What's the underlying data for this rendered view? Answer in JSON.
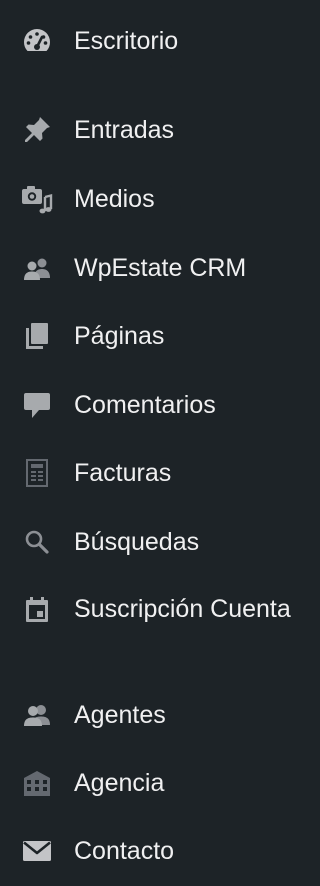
{
  "sidebar": {
    "items": [
      {
        "label": "Escritorio",
        "icon": "dashboard-icon"
      },
      {
        "label": "Entradas",
        "icon": "pin-icon"
      },
      {
        "label": "Medios",
        "icon": "media-icon"
      },
      {
        "label": "WpEstate CRM",
        "icon": "users-icon"
      },
      {
        "label": "Páginas",
        "icon": "pages-icon"
      },
      {
        "label": "Comentarios",
        "icon": "comment-icon"
      },
      {
        "label": "Facturas",
        "icon": "invoice-icon"
      },
      {
        "label": "Búsquedas",
        "icon": "search-icon"
      },
      {
        "label": "Suscripción Cuenta",
        "icon": "calendar-icon"
      },
      {
        "label": "Agentes",
        "icon": "agents-icon"
      },
      {
        "label": "Agencia",
        "icon": "building-icon"
      },
      {
        "label": "Contacto",
        "icon": "email-icon"
      }
    ]
  },
  "colors": {
    "background": "#1d2327",
    "text": "#f0f0f1",
    "icon": "#a7aaad",
    "icon_bright": "#c3c4c7"
  }
}
